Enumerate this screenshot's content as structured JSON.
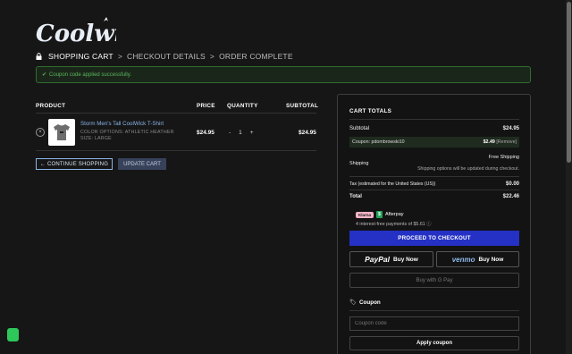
{
  "brand": {
    "logo_text": "Coolwick"
  },
  "breadcrumb": {
    "steps": [
      "SHOPPING CART",
      "CHECKOUT DETAILS",
      "ORDER COMPLETE"
    ],
    "separator": ">"
  },
  "notice": {
    "text": "Coupon code applied successfully."
  },
  "table": {
    "headers": {
      "product": "PRODUCT",
      "price": "PRICE",
      "quantity": "QUANTITY",
      "subtotal": "SUBTOTAL"
    },
    "items": [
      {
        "name": "Storm Men's Tall CoolWick T-Shirt",
        "meta_color": "COLOR OPTIONS:  ATHLETIC HEATHER",
        "meta_size": "SIZE:  LARGE",
        "price": "$24.95",
        "qty_minus": "-",
        "qty": "1",
        "qty_plus": "+",
        "subtotal": "$24.95",
        "remove": "×"
      }
    ]
  },
  "actions": {
    "continue": "← CONTINUE SHOPPING",
    "update": "UPDATE CART"
  },
  "totals": {
    "title": "CART TOTALS",
    "subtotal_label": "Subtotal",
    "subtotal_value": "$24.95",
    "coupon_label": "Coupon: pdombrowski10",
    "coupon_value": "$2.49",
    "coupon_remove": "[Remove]",
    "shipping_label": "Shipping",
    "shipping_value": "Free Shipping",
    "shipping_note": "Shipping options will be updated during checkout.",
    "tax_label": "Tax (estimated for the United States (US))",
    "tax_value": "$0.00",
    "total_label": "Total",
    "total_value": "$22.46"
  },
  "afterpay": {
    "klarna_badge": "Klarna",
    "label": "Afterpay",
    "sub": "4 interest-free payments of $5.61 ⓘ"
  },
  "checkout": {
    "proceed": "PROCEED TO CHECKOUT",
    "paypal_logo": "PayPal",
    "paypal_label": "Buy Now",
    "venmo_logo": "venmo",
    "venmo_label": "Buy Now",
    "gpay": "Buy with G Pay"
  },
  "coupon": {
    "title": "Coupon",
    "placeholder": "Coupon code",
    "apply": "Apply coupon"
  },
  "colors": {
    "accent_blue": "#2431c4",
    "link_blue": "#8ab4e8",
    "success_green": "#5ab75a"
  }
}
